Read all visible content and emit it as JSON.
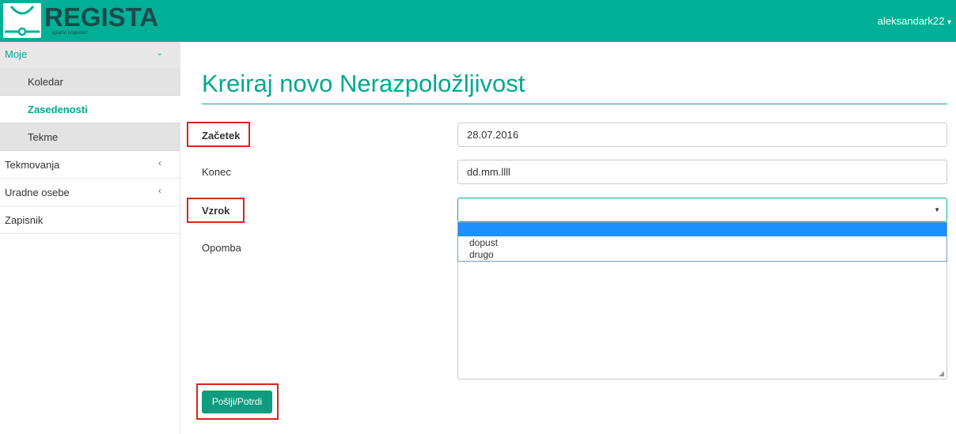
{
  "header": {
    "logo_text": "REGISTA",
    "logo_subtitle": "igramo nogomet!",
    "user_label": "aleksandark22",
    "user_caret": "▾"
  },
  "sidebar": {
    "items": [
      {
        "label": "Moje",
        "chevron": "⌄"
      },
      {
        "label": "Koledar"
      },
      {
        "label": "Zasedenosti"
      },
      {
        "label": "Tekme"
      },
      {
        "label": "Tekmovanja",
        "chevron": "‹"
      },
      {
        "label": "Uradne osebe",
        "chevron": "‹"
      },
      {
        "label": "Zapisnik"
      }
    ]
  },
  "main": {
    "title": "Kreiraj novo Nerazpoložljivost",
    "form": {
      "start_label": "Začetek",
      "start_value": "28.07.2016",
      "end_label": "Konec",
      "end_placeholder": "dd.mm.llll",
      "reason_label": "Vzrok",
      "reason_value": "",
      "reason_options": [
        "",
        "dopust",
        "drugo"
      ],
      "note_label": "Opomba",
      "submit_label": "Pošlji/Potrdi"
    }
  },
  "colors": {
    "brand": "#00b096",
    "accent_text": "#00a98f",
    "button": "#0f9c80",
    "highlight": "#d9251c",
    "option_selected": "#1e90ff"
  }
}
